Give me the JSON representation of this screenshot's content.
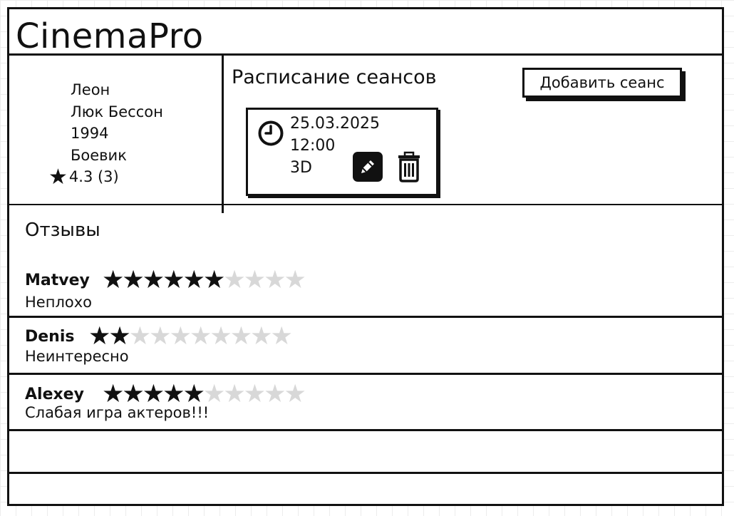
{
  "app": {
    "title": "CinemaPro"
  },
  "movie": {
    "title": "Леон",
    "director": "Люк Бессон",
    "year": "1994",
    "genre": "Боевик",
    "rating": "4.3 (3)"
  },
  "schedule": {
    "title": "Расписание сеансов",
    "add_button_label": "Добавить сеанс",
    "sessions": [
      {
        "date": "25.03.2025",
        "time": "12:00",
        "format": "3D"
      }
    ]
  },
  "reviews": {
    "title": "Отзывы",
    "max_stars": 10,
    "items": [
      {
        "author": "Matvey",
        "stars": 6,
        "text": "Неплохо"
      },
      {
        "author": "Denis",
        "stars": 2,
        "text": "Неинтересно"
      },
      {
        "author": "Alexey",
        "stars": 5,
        "text": "Слабая игра актеров!!!"
      }
    ]
  },
  "icons": {
    "rating": "star-icon",
    "session_time": "clock-icon",
    "edit": "pencil-icon",
    "delete": "trash-icon"
  },
  "colors": {
    "ink": "#111111",
    "star_empty": "#d8d8d8",
    "background": "#ffffff"
  }
}
